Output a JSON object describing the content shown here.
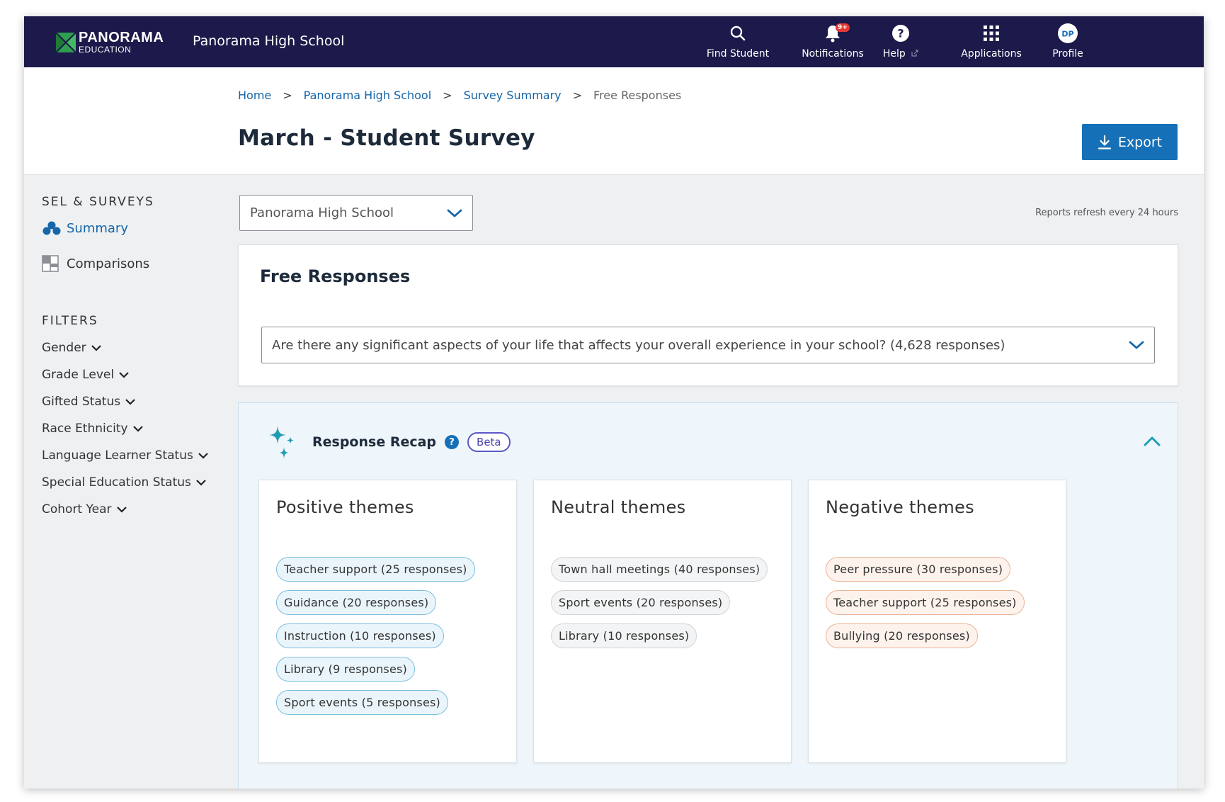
{
  "topbar": {
    "brand_line1": "PANORAMA",
    "brand_line2": "EDUCATION",
    "school": "Panorama High School",
    "notification_badge": "9+",
    "nav": [
      {
        "label": "Find Student",
        "icon": "search-icon"
      },
      {
        "label": "Notifications",
        "icon": "bell-icon"
      },
      {
        "label": "Help",
        "icon": "help-icon"
      },
      {
        "label": "Applications",
        "icon": "grid-icon"
      },
      {
        "label": "Profile",
        "icon": "avatar",
        "initials": "DP"
      }
    ]
  },
  "breadcrumb": {
    "items": [
      "Home",
      "Panorama High School",
      "Survey Summary"
    ],
    "separator": ">",
    "current": "Free Responses"
  },
  "page": {
    "title": "March - Student Survey",
    "export_label": "Export"
  },
  "sidebar": {
    "section1": "SEL & SURVEYS",
    "items": [
      {
        "label": "Summary",
        "icon": "summary-icon",
        "active": true
      },
      {
        "label": "Comparisons",
        "icon": "comparisons-icon",
        "active": false
      }
    ],
    "section2": "FILTERS",
    "filters": [
      "Gender",
      "Grade Level",
      "Gifted Status",
      "Race Ethnicity",
      "Language Learner Status",
      "Special Education Status",
      "Cohort Year"
    ]
  },
  "main": {
    "school_select": "Panorama High School",
    "refresh_note": "Reports refresh every 24 hours",
    "free_responses": {
      "title": "Free Responses",
      "question": "Are there any significant aspects of your life that affects your overall experience in your school? (4,628 responses)"
    },
    "recap": {
      "title": "Response Recap",
      "help": "?",
      "beta": "Beta",
      "themes": [
        {
          "title": "Positive themes",
          "tone": "pos",
          "chips": [
            "Teacher support (25 responses)",
            "Guidance (20 responses)",
            "Instruction (10 responses)",
            "Library (9 responses)",
            "Sport events (5 responses)"
          ]
        },
        {
          "title": "Neutral themes",
          "tone": "neu",
          "chips": [
            "Town hall meetings (40 responses)",
            "Sport events (20 responses)",
            "Library (10 responses)"
          ]
        },
        {
          "title": "Negative themes",
          "tone": "neg",
          "chips": [
            "Peer pressure (30 responses)",
            "Teacher support (25 responses)",
            "Bullying (20 responses)"
          ]
        }
      ]
    }
  },
  "colors": {
    "topbar": "#1c1a4a",
    "accent": "#1670b7",
    "link": "#1565a8",
    "recap_bg": "#eef6fb"
  }
}
